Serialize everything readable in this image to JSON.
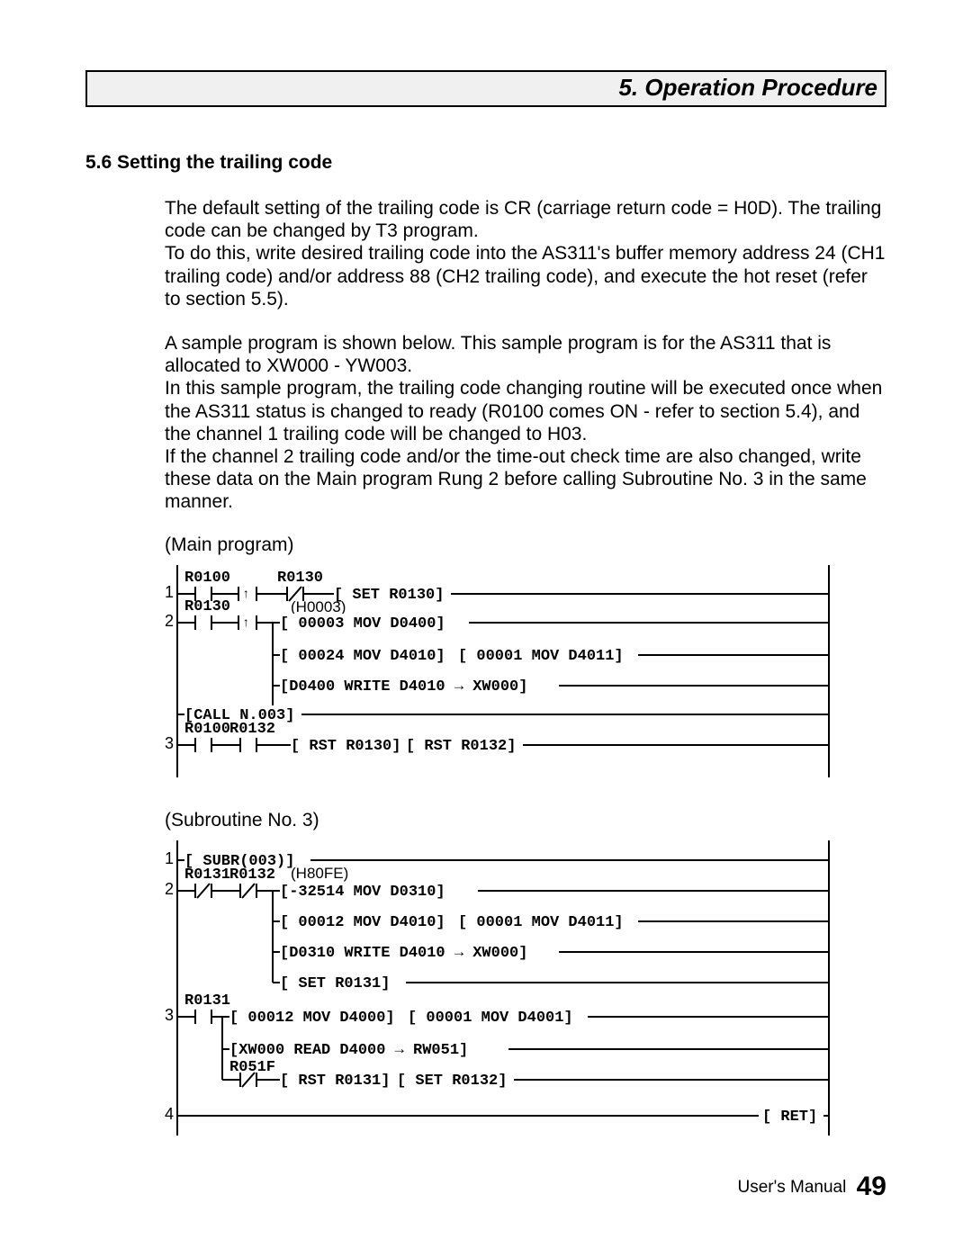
{
  "chapter_title": "5. Operation Procedure",
  "section_heading": "5.6  Setting the trailing code",
  "para1": "The default setting of the trailing code is CR (carriage return code = H0D). The trailing code can be changed by T3 program.",
  "para2": "To do this, write desired trailing code into the AS311's buffer memory address 24 (CH1 trailing code) and/or address 88 (CH2 trailing code), and execute the hot reset (refer to section 5.5).",
  "para3": "A sample program is shown below. This sample program is for the AS311 that is allocated to XW000 - YW003.",
  "para4": "In this sample program, the trailing code changing routine will be executed once when the AS311 status is changed to ready (R0100 comes ON - refer to section 5.4), and the channel 1 trailing code will be changed to H03.",
  "para5": "If the channel 2 trailing code and/or the time-out check time are also changed, write these data on the Main program Rung 2 before calling Subroutine No. 3 in the same manner.",
  "main_label": "(Main program)",
  "sub_label": "(Subroutine No. 3)",
  "main": {
    "r1": {
      "c1": "R0100",
      "c2": "R0130",
      "inst": "[ SET R0130]"
    },
    "r2": {
      "c1": "R0130",
      "annot": "(H0003)",
      "i1": "[ 00003 MOV D0400]",
      "i2a": "[ 00024 MOV D4010]",
      "i2b": "[ 00001 MOV D4011]",
      "i3": "[D0400 WRITE D4010  →  XW000]",
      "i4": "[CALL N.003]"
    },
    "r3": {
      "c1": "R0100",
      "c2": "R0132",
      "i1": "[ RST R0130]",
      "i2": "[ RST R0132]"
    }
  },
  "sub": {
    "r1": {
      "i": "[ SUBR(003)]"
    },
    "r2": {
      "c1": "R0131",
      "c2": "R0132",
      "annot": "(H80FE)",
      "i1": "[-32514 MOV D0310]",
      "i2a": "[ 00012 MOV D4010]",
      "i2b": "[ 00001 MOV D4011]",
      "i3": "[D0310 WRITE D4010  →  XW000]",
      "i4": "[ SET R0131]"
    },
    "r3": {
      "c1": "R0131",
      "i1a": "[ 00012 MOV D4000]",
      "i1b": "[ 00001 MOV D4001]",
      "i2": "[XW000 READ  D4000  →  RW051]",
      "c2": "R051F",
      "i3a": "[ RST R0131]",
      "i3b": "[ SET R0132]"
    },
    "r4": {
      "i": "[ RET]"
    }
  },
  "footer_label": "User's Manual",
  "page_number": "49"
}
